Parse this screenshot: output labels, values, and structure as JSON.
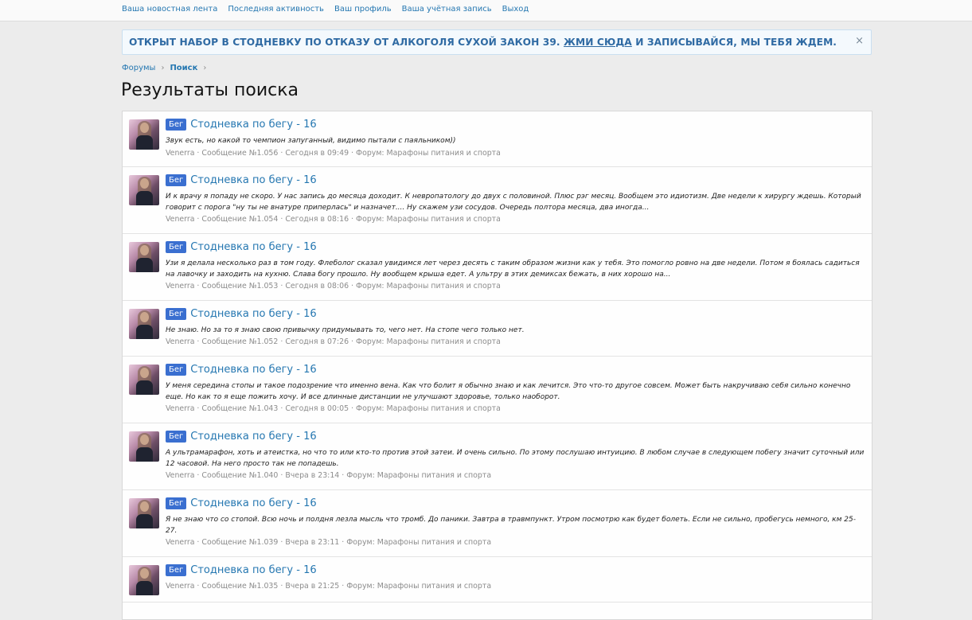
{
  "topnav": {
    "links": [
      "Ваша новостная лента",
      "Последняя активность",
      "Ваш профиль",
      "Ваша учётная запись",
      "Выход"
    ]
  },
  "notice": {
    "text_before": "ОТКРЫТ НАБОР В СТОДНЕВКУ ПО ОТКАЗУ ОТ АЛКОГОЛЯ СУХОЙ ЗАКОН 39.",
    "link": "ЖМИ СЮДА",
    "text_after": "И ЗАПИСЫВАЙСЯ, МЫ ТЕБЯ ЖДЕМ.",
    "close_icon": "×"
  },
  "breadcrumb": {
    "items": [
      "Форумы",
      "Поиск"
    ],
    "separator": "›"
  },
  "page_title": "Результаты поиска",
  "results": [
    {
      "badge": "Бег",
      "title": "Стодневка по бегу - 16",
      "snippet": "Звук есть, но какой то чемпион запуганный, видимо пытали с паяльником))",
      "author": "Venerra",
      "post": "Сообщение №1.056",
      "time": "Сегодня в 09:49",
      "forum_label": "Форум:",
      "forum": "Марафоны питания и спорта"
    },
    {
      "badge": "Бег",
      "title": "Стодневка по бегу - 16",
      "snippet": "И к врачу я попаду не скоро. У нас запись до месяца доходит. К невропатологу до двух с половиной. Плюс рэг месяц. Вообщем это идиотизм. Две недели к хирургу ждешь. Который говорит с порога \"ну ты не внатуре приперлась\" и назначет.... Ну скажем узи сосудов. Очередь полтора месяца, два иногда...",
      "author": "Venerra",
      "post": "Сообщение №1.054",
      "time": "Сегодня в 08:16",
      "forum_label": "Форум:",
      "forum": "Марафоны питания и спорта"
    },
    {
      "badge": "Бег",
      "title": "Стодневка по бегу - 16",
      "snippet": "Узи я делала несколько раз в том году. Флеболог сказал увидимся лет через десять с таким образом жизни как у тебя. Это помогло ровно на две недели. Потом я боялась садиться на лавочку и заходить на кухню. Слава богу прошло. Ну вообщем крыша едет. А ультру в этих демиксах бежать, в них хорошо на...",
      "author": "Venerra",
      "post": "Сообщение №1.053",
      "time": "Сегодня в 08:06",
      "forum_label": "Форум:",
      "forum": "Марафоны питания и спорта"
    },
    {
      "badge": "Бег",
      "title": "Стодневка по бегу - 16",
      "snippet": "Не знаю. Но за то я знаю свою привычку придумывать то, чего нет. На стопе чего только нет.",
      "author": "Venerra",
      "post": "Сообщение №1.052",
      "time": "Сегодня в 07:26",
      "forum_label": "Форум:",
      "forum": "Марафоны питания и спорта"
    },
    {
      "badge": "Бег",
      "title": "Стодневка по бегу - 16",
      "snippet": "У меня середина стопы и такое подозрение что именно вена. Как что болит я обычно знаю и как лечится. Это что-то другое совсем. Может быть накручиваю себя сильно конечно еще. Но как то я еще пожить хочу. И все длинные дистанции не улучшают здоровье, только наоборот.",
      "author": "Venerra",
      "post": "Сообщение №1.043",
      "time": "Сегодня в 00:05",
      "forum_label": "Форум:",
      "forum": "Марафоны питания и спорта"
    },
    {
      "badge": "Бег",
      "title": "Стодневка по бегу - 16",
      "snippet": "А ультрамарафон, хоть и атеистка, но что то или кто-то против этой затеи. И очень сильно. По этому послушаю интуицию. В любом случае в следующем побегу значит суточный или 12 часовой. На него просто так не попадешь.",
      "author": "Venerra",
      "post": "Сообщение №1.040",
      "time": "Вчера в 23:14",
      "forum_label": "Форум:",
      "forum": "Марафоны питания и спорта"
    },
    {
      "badge": "Бег",
      "title": "Стодневка по бегу - 16",
      "snippet": "Я не знаю что со стопой. Всю ночь и полдня лезла мысль что тромб. До паники. Завтра в травмпункт. Утром посмотрю как будет болеть. Если не сильно, пробегусь немного, км 25-27.",
      "author": "Venerra",
      "post": "Сообщение №1.039",
      "time": "Вчера в 23:11",
      "forum_label": "Форум:",
      "forum": "Марафоны питания и спорта"
    },
    {
      "badge": "Бег",
      "title": "Стодневка по бегу - 16",
      "snippet": "",
      "author": "Venerra",
      "post": "Сообщение №1.035",
      "time": "Вчера в 21:25",
      "forum_label": "Форум:",
      "forum": "Марафоны питания и спорта"
    }
  ]
}
